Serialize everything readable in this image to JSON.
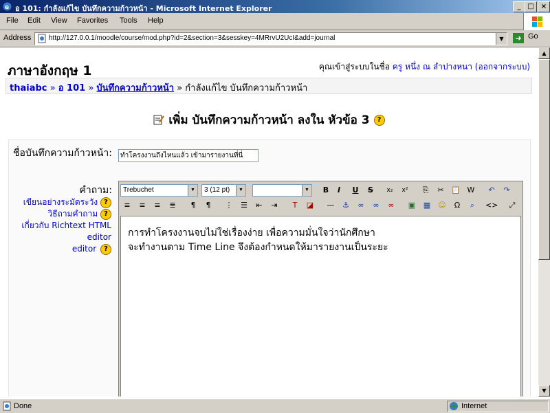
{
  "window": {
    "title": "อ 101: กำลังแก้ไข บันทึกความก้าวหน้า - Microsoft Internet Explorer",
    "min": "_",
    "max": "□",
    "close": "×"
  },
  "menu": [
    "File",
    "Edit",
    "View",
    "Favorites",
    "Tools",
    "Help"
  ],
  "address": {
    "label": "Address",
    "url": "http://127.0.0.1/moodle/course/mod.php?id=2&section=3&sesskey=4MRrvU2UcI&add=journal",
    "go": "Go"
  },
  "page": {
    "course_title": "ภาษาอังกฤษ 1",
    "login_text": "คุณเข้าสู่ระบบในชื่อ",
    "login_user": "ครู หนึ่ง ณ ลำปางหนา",
    "logout": "(ออกจากระบบ)",
    "breadcrumb": {
      "home": "thaiabc",
      "sep": " » ",
      "course": "อ 101",
      "module": "บันทึกความก้าวหน้า",
      "current": "กำลังแก้ไข บันทึกความก้าวหน้า"
    },
    "heading": "เพิ่ม บันทึกความก้าวหน้า ลงใน หัวข้อ 3",
    "help_glyph": "?"
  },
  "form": {
    "name_label": "ชื่อบันทึกความก้าวหน้า:",
    "name_value": "ทำโครงงานถึงไหนแล้ว เข้ามารายงานที่นี่",
    "question_label": "คำถาม:",
    "help_links": [
      "เขียนอย่างระมัดระวัง",
      "วิธีถามคำถาม",
      "เกี่ยวกับ Richtext HTML editor"
    ],
    "editor": {
      "font": "Trebuchet",
      "size": "3 (12 pt)",
      "format": "",
      "content_lines": [
        "การทำโครงงานจบไม่ใช่เรื่องง่าย เพื่อความมั่นใจว่านักศึกษา",
        "จะทำงานตาม Time Line จึงต้องกำหนดให้มารายงานเป็นระยะ"
      ]
    }
  },
  "status": {
    "text": "Done",
    "zone": "Internet"
  }
}
